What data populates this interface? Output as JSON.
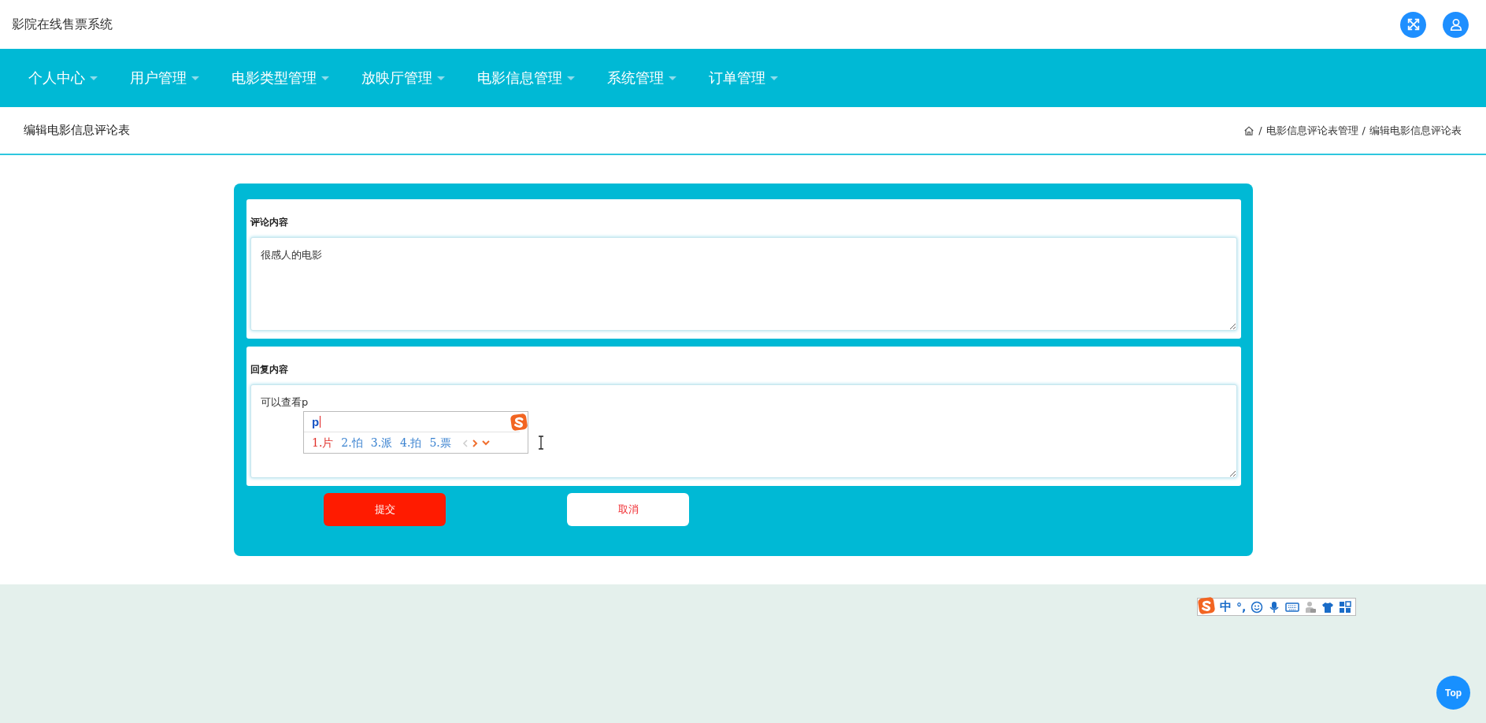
{
  "header": {
    "title": "影院在线售票系统"
  },
  "nav": {
    "items": [
      {
        "label": "个人中心"
      },
      {
        "label": "用户管理"
      },
      {
        "label": "电影类型管理"
      },
      {
        "label": "放映厅管理"
      },
      {
        "label": "电影信息管理"
      },
      {
        "label": "系统管理"
      },
      {
        "label": "订单管理"
      }
    ]
  },
  "page_header": {
    "title": "编辑电影信息评论表",
    "breadcrumb": [
      {
        "kind": "home"
      },
      {
        "kind": "separator",
        "text": "/"
      },
      {
        "kind": "link",
        "text": "电影信息评论表管理"
      },
      {
        "kind": "separator",
        "text": "/"
      },
      {
        "kind": "current",
        "text": "编辑电影信息评论表"
      }
    ]
  },
  "form": {
    "fields": [
      {
        "label": "评论内容",
        "value": "很感人的电影"
      },
      {
        "label": "回复内容",
        "value": "可以查看p"
      }
    ],
    "buttons": [
      {
        "label": "提交",
        "kind": "primary"
      },
      {
        "label": "取消",
        "kind": "secondary"
      }
    ]
  },
  "ime_popup": {
    "composition": "p",
    "candidates": [
      {
        "label": "1.片",
        "selected": true
      },
      {
        "label": "2.怕",
        "selected": false
      },
      {
        "label": "3.派",
        "selected": false
      },
      {
        "label": "4.拍",
        "selected": false
      },
      {
        "label": "5.票",
        "selected": false
      }
    ]
  },
  "ime_toolbar": {
    "mode": "中",
    "punctuation": "°,"
  },
  "back_to_top": {
    "label": "Top"
  }
}
